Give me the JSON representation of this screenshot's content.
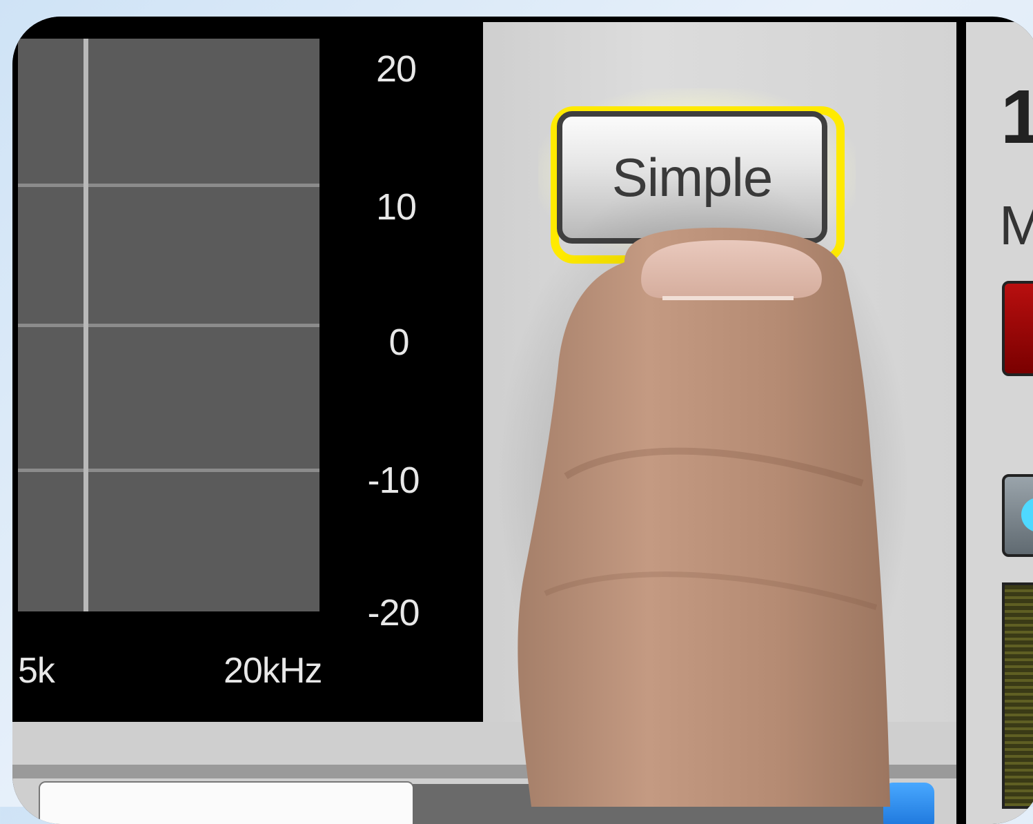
{
  "eq_graph": {
    "db_scale": [
      "20",
      "10",
      "0",
      "-10",
      "-20"
    ],
    "freq_scale": [
      "5k",
      "20kHz"
    ]
  },
  "controls": {
    "simple_button_label": "Simple",
    "simple_button_highlight_color": "#ffea00"
  },
  "right_panel": {
    "channel_number_partial": "1",
    "label_partial": "M"
  },
  "colors": {
    "eq_plot_bg": "#5b5b5b",
    "panel_grey": "#d6d6d6",
    "mute_red": "#b80f0f",
    "accent_blue": "#2f8ff0",
    "indicator_cyan": "#4fd9ff"
  }
}
